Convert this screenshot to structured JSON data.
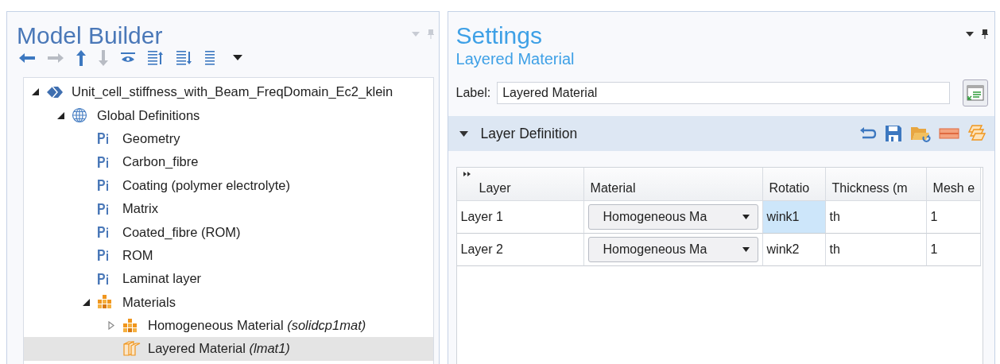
{
  "model_builder": {
    "title": "Model Builder",
    "toolbar": [
      {
        "kind": "back",
        "disabled": false
      },
      {
        "kind": "forward",
        "disabled": true
      },
      {
        "kind": "up",
        "disabled": false
      },
      {
        "kind": "down",
        "disabled": true
      },
      {
        "kind": "eye",
        "disabled": false
      },
      {
        "kind": "collapse",
        "disabled": false
      },
      {
        "kind": "expand",
        "disabled": false
      },
      {
        "kind": "list",
        "disabled": false
      },
      {
        "kind": "caret",
        "disabled": false
      }
    ],
    "tree": [
      {
        "label": "Unit_cell_stiffness_with_Beam_FreqDomain_Ec2_klein",
        "kind": "model",
        "expanded": true,
        "selected": false,
        "children": [
          {
            "label": "Global Definitions",
            "kind": "globe",
            "expanded": true,
            "selected": false,
            "children": [
              {
                "label": "Geometry",
                "kind": "param",
                "selected": false
              },
              {
                "label": "Carbon_fibre",
                "kind": "param",
                "selected": false
              },
              {
                "label": "Coating (polymer electrolyte)",
                "kind": "param",
                "selected": false
              },
              {
                "label": "Matrix",
                "kind": "param",
                "selected": false
              },
              {
                "label": "Coated_fibre (ROM)",
                "kind": "param",
                "selected": false
              },
              {
                "label": "ROM",
                "kind": "param",
                "selected": false
              },
              {
                "label": "Laminat layer",
                "kind": "param",
                "selected": false
              },
              {
                "label": "Materials",
                "kind": "materials",
                "expanded": true,
                "selected": false,
                "children": [
                  {
                    "label": "Homogeneous Material  *(solidcp1mat)*",
                    "kind": "materials",
                    "expanded": false,
                    "selected": false
                  },
                  {
                    "label": "Layered Material  *(lmat1)*",
                    "kind": "layered",
                    "selected": true
                  }
                ]
              }
            ]
          }
        ]
      }
    ]
  },
  "settings": {
    "title": "Settings",
    "subtitle": "Layered Material",
    "label_field": {
      "label": "Label:",
      "value": "Layered Material"
    },
    "section": {
      "title": "Layer Definition",
      "expanded": true,
      "tools": [
        {
          "kind": "undo"
        },
        {
          "kind": "save"
        },
        {
          "kind": "load"
        },
        {
          "kind": "remove"
        },
        {
          "kind": "layers"
        }
      ]
    },
    "table": {
      "columns": [
        "Layer",
        "Material",
        "Rotatio",
        "Thickness (m",
        "Mesh e"
      ],
      "rows": [
        {
          "cells": [
            {
              "kind": "text",
              "text": "Layer 1",
              "selected": false
            },
            {
              "kind": "dropdown",
              "text": "Homogeneous Ma",
              "selected": false
            },
            {
              "kind": "text",
              "text": "wink1",
              "selected": true
            },
            {
              "kind": "text",
              "text": "th",
              "selected": false
            },
            {
              "kind": "text",
              "text": "1",
              "selected": false
            }
          ]
        },
        {
          "cells": [
            {
              "kind": "text",
              "text": "Layer 2",
              "selected": false
            },
            {
              "kind": "dropdown",
              "text": "Homogeneous Ma",
              "selected": false
            },
            {
              "kind": "text",
              "text": "wink2",
              "selected": false
            },
            {
              "kind": "text",
              "text": "th",
              "selected": false
            },
            {
              "kind": "text",
              "text": "1",
              "selected": false
            }
          ]
        }
      ]
    }
  }
}
